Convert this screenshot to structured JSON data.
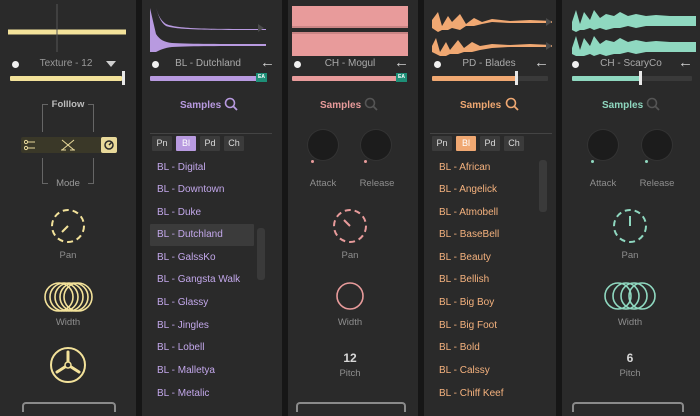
{
  "colors": {
    "yellow": "#f3e29a",
    "purple": "#b89ae0",
    "pink": "#e89b9b",
    "orange": "#f0a872",
    "teal": "#8fd8c0"
  },
  "panel0": {
    "name": "Texture - 12",
    "follow_label": "Folllow",
    "mode_label": "Mode",
    "pan_label": "Pan",
    "width_label": "Width"
  },
  "panel1": {
    "name": "BL - Dutchland",
    "badge": "EA",
    "samples_label": "Samples",
    "tabs": [
      "Pn",
      "Bl",
      "Pd",
      "Ch"
    ],
    "active_tab": "Bl",
    "items": [
      "BL - Digital",
      "BL - Downtown",
      "BL - Duke",
      "BL - Dutchland",
      "BL - GalssKo",
      "BL - Gangsta Walk",
      "BL - Glassy",
      "BL - Jingles",
      "BL - Lobell",
      "BL - Malletya",
      "BL - Metalic"
    ],
    "selected": "BL - Dutchland"
  },
  "panel2": {
    "name": "CH - Mogul",
    "badge": "EA",
    "samples_label": "Samples",
    "attack_label": "Attack",
    "release_label": "Release",
    "pan_label": "Pan",
    "width_label": "Width",
    "pitch_value": "12",
    "pitch_label": "Pitch"
  },
  "panel3": {
    "name": "PD - Blades",
    "samples_label": "Samples",
    "tabs": [
      "Pn",
      "Bl",
      "Pd",
      "Ch"
    ],
    "active_tab": "Bl",
    "items": [
      "BL - African",
      "BL - Angelick",
      "BL - Atmobell",
      "BL - BaseBell",
      "BL - Beauty",
      "BL - Bellish",
      "BL - Big Boy",
      "BL - Big Foot",
      "BL - Bold",
      "BL - Calssy",
      "BL - Chiff Keef"
    ]
  },
  "panel4": {
    "name": "CH - ScaryCo",
    "samples_label": "Samples",
    "attack_label": "Attack",
    "release_label": "Release",
    "pan_label": "Pan",
    "width_label": "Width",
    "pitch_value": "6",
    "pitch_label": "Pitch"
  }
}
